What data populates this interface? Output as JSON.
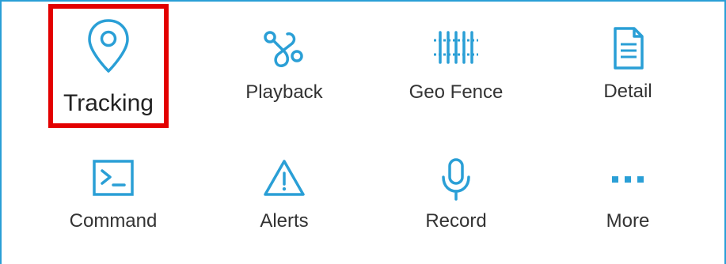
{
  "accent_color": "#2a9fd6",
  "highlight_color": "#e30000",
  "menu": {
    "items": [
      {
        "label": "Tracking",
        "icon": "location-pin-icon"
      },
      {
        "label": "Playback",
        "icon": "route-icon"
      },
      {
        "label": "Geo Fence",
        "icon": "fence-icon"
      },
      {
        "label": "Detail",
        "icon": "document-icon"
      },
      {
        "label": "Command",
        "icon": "terminal-icon"
      },
      {
        "label": "Alerts",
        "icon": "warning-triangle-icon"
      },
      {
        "label": "Record",
        "icon": "microphone-icon"
      },
      {
        "label": "More",
        "icon": "more-dots-icon"
      }
    ]
  }
}
